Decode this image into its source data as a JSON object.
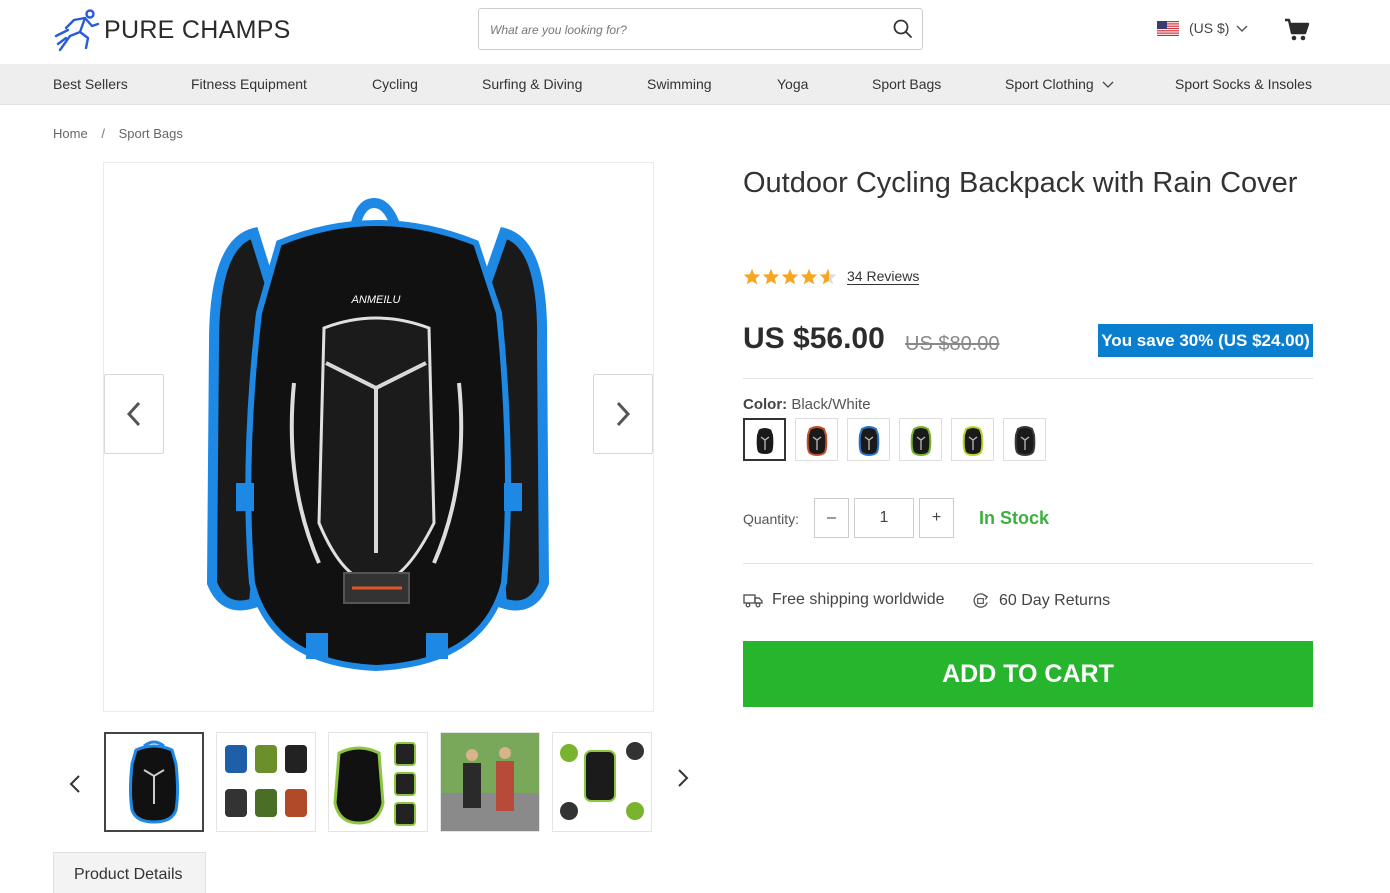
{
  "header": {
    "brand": "PURE CHAMPS",
    "search_placeholder": "What are you looking for?",
    "currency": "(US $)"
  },
  "nav": {
    "items": [
      {
        "label": "Best Sellers"
      },
      {
        "label": "Fitness Equipment"
      },
      {
        "label": "Cycling"
      },
      {
        "label": "Surfing & Diving"
      },
      {
        "label": "Swimming"
      },
      {
        "label": "Yoga"
      },
      {
        "label": "Sport Bags"
      },
      {
        "label": "Sport Clothing"
      },
      {
        "label": "Sport Socks & Insoles"
      }
    ]
  },
  "breadcrumb": {
    "home": "Home",
    "separator": "/",
    "current": "Sport Bags"
  },
  "product": {
    "title": "Outdoor Cycling Backpack with Rain Cover",
    "rating": 4.5,
    "reviews": "34 Reviews",
    "price": "US $56.00",
    "old_price": "US $80.00",
    "save": "You save 30% (US $24.00)",
    "color_label": "Color:",
    "color_value": "Black/White",
    "swatch_colors": [
      "#ffffff",
      "#c0532a",
      "#2a74c9",
      "#7ab32d",
      "#b5d62b",
      "#3a3a3a"
    ],
    "quantity_label": "Quantity:",
    "quantity": "1",
    "qty_minus": "–",
    "qty_plus": "+",
    "stock": "In Stock",
    "shipping": "Free shipping worldwide",
    "returns": "60 Day Returns",
    "add_to_cart": "ADD TO CART"
  },
  "tabs": {
    "details": "Product Details"
  },
  "colors": {
    "accent_blue": "#0b7fcf",
    "cta_green": "#26b52c",
    "stock_green": "#3cb03c",
    "star": "#f5a623"
  }
}
